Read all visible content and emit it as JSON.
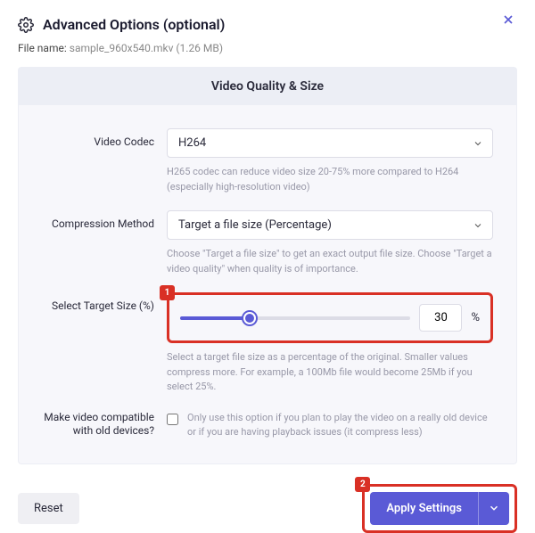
{
  "header": {
    "title": "Advanced Options (optional)"
  },
  "file": {
    "label": "File name:",
    "name": "sample_960x540.mkv",
    "size": "(1.26 MB)"
  },
  "panel": {
    "title": "Video Quality & Size"
  },
  "codec": {
    "label": "Video Codec",
    "value": "H264",
    "help": "H265 codec can reduce video size 20-75% more compared to H264 (especially high-resolution video)"
  },
  "method": {
    "label": "Compression Method",
    "value": "Target a file size (Percentage)",
    "help": "Choose \"Target a file size\" to get an exact output file size. Choose \"Target a video quality\" when quality is of importance."
  },
  "target": {
    "label": "Select Target Size (%)",
    "value": "30",
    "percent": 30,
    "sign": "%",
    "help": "Select a target file size as a percentage of the original. Smaller values compress more. For example, a 100Mb file would become 25Mb if you select 25%."
  },
  "compat": {
    "label": "Make video compatible with old devices?",
    "checked": false,
    "help": "Only use this option if you plan to play the video on a really old device or if you are having playback issues (it compress less)"
  },
  "footer": {
    "reset": "Reset",
    "apply": "Apply Settings"
  },
  "callouts": {
    "slider": "1",
    "apply": "2"
  }
}
